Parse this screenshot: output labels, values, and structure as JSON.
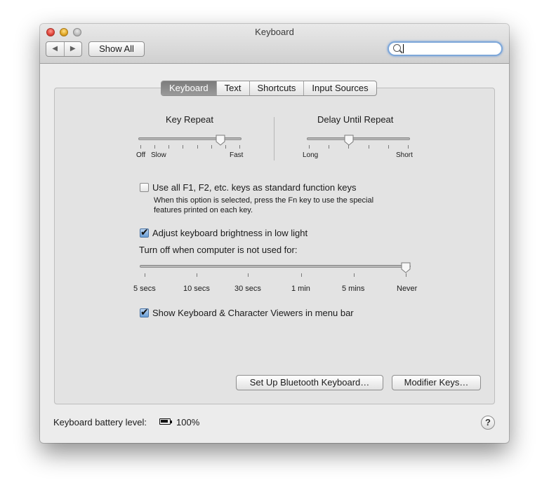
{
  "window": {
    "title": "Keyboard"
  },
  "toolbar": {
    "back_glyph": "◀",
    "forward_glyph": "▶",
    "show_all": "Show All",
    "search_placeholder": ""
  },
  "tabs": [
    {
      "label": "Keyboard",
      "active": true
    },
    {
      "label": "Text",
      "active": false
    },
    {
      "label": "Shortcuts",
      "active": false
    },
    {
      "label": "Input Sources",
      "active": false
    }
  ],
  "key_repeat": {
    "title": "Key Repeat",
    "label_off": "Off",
    "label_slow": "Slow",
    "label_fast": "Fast",
    "value_fraction": 0.83
  },
  "delay_until_repeat": {
    "title": "Delay Until Repeat",
    "label_long": "Long",
    "label_short": "Short",
    "value_fraction": 0.4
  },
  "fn_keys": {
    "label": "Use all F1, F2, etc. keys as standard function keys",
    "checked": false,
    "description_line1": "When this option is selected, press the Fn key to use the special",
    "description_line2": "features printed on each key."
  },
  "brightness": {
    "label": "Adjust keyboard brightness in low light",
    "checked": true,
    "turn_off_label": "Turn off when computer is not used for:",
    "ticks": [
      "5 secs",
      "10 secs",
      "30 secs",
      "1 min",
      "5 mins",
      "Never"
    ],
    "value": "Never"
  },
  "viewers": {
    "label": "Show Keyboard & Character Viewers in menu bar",
    "checked": true
  },
  "buttons": {
    "bluetooth": "Set Up Bluetooth Keyboard…",
    "modifier": "Modifier Keys…"
  },
  "footer": {
    "battery_label": "Keyboard battery level:",
    "battery_value": "100%",
    "help": "?"
  },
  "icons": [
    "close-button",
    "minimize-button",
    "zoom-button",
    "search-icon",
    "battery-icon",
    "help-icon"
  ]
}
